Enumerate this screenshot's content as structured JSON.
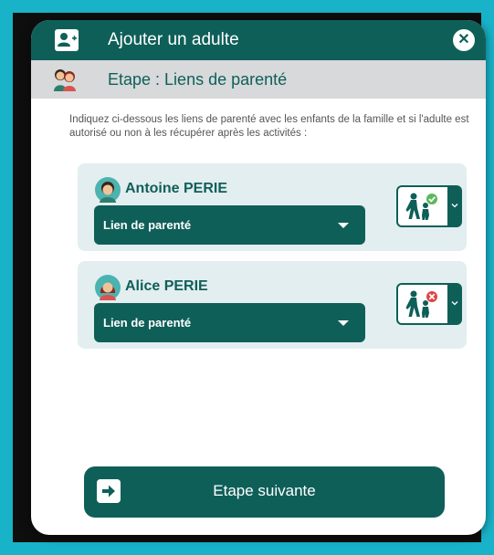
{
  "dialog": {
    "title": "Ajouter un adulte",
    "close_label": "✕",
    "step_title": "Etape : Liens de parenté",
    "intro_text": "Indiquez ci-dessous les liens de parenté avec les enfants de la famille et si l'adulte est autorisé ou non à les récupérer après les activités :",
    "next_label": "Etape suivante"
  },
  "children": [
    {
      "name": "Antoine PERIE",
      "relation_placeholder": "Lien de parenté",
      "pickup_status": "authorized",
      "avatar_hair": "#3a2414",
      "status_color": "#5cb85c"
    },
    {
      "name": "Alice PERIE",
      "relation_placeholder": "Lien de parenté",
      "pickup_status": "not-authorized",
      "avatar_hair": "#8c2a1a",
      "status_color": "#e04545"
    }
  ],
  "colors": {
    "primary": "#0f5f59",
    "card_bg": "#e3eef0",
    "stepbar_bg": "#d7d9da",
    "frame_accent": "#18b3c8"
  }
}
